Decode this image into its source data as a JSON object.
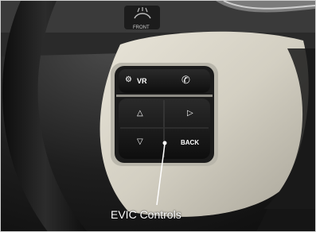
{
  "callout": {
    "label": "EVIC Controls"
  },
  "background": {
    "icon_label": "FRONT"
  },
  "buttons": {
    "voice_label": "VR",
    "back_label": "BACK"
  },
  "icons": [
    "voice-recognition-icon",
    "phone-icon",
    "arrow-up-icon",
    "arrow-right-icon",
    "arrow-down-icon",
    "front-defrost-icon"
  ]
}
